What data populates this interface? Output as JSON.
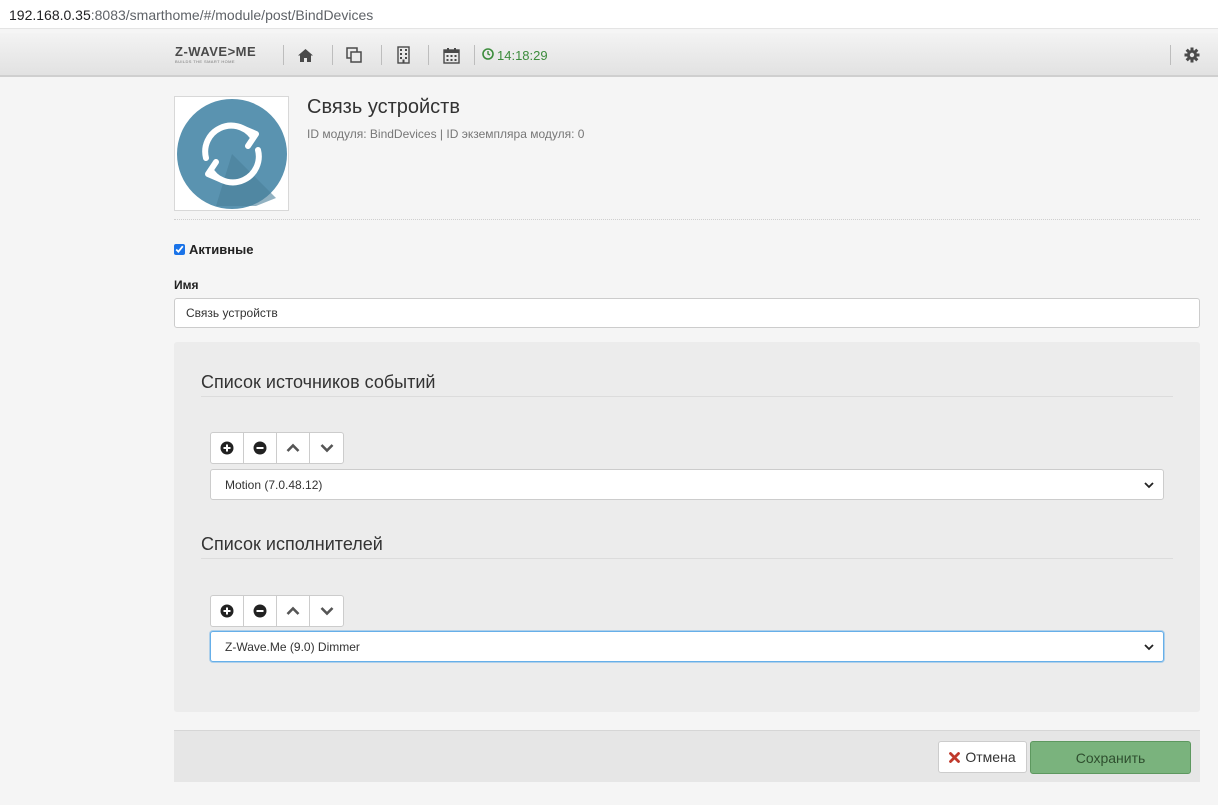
{
  "browser": {
    "url_host": "192.168.0.35",
    "url_rest": ":8083/smarthome/#/module/post/BindDevices"
  },
  "nav": {
    "logo_text": "Z-WAVE>ME",
    "logo_tagline": "BUILDS THE SMART HOME",
    "time": "14:18:29",
    "icons": [
      "home-icon",
      "copy-icon",
      "building-icon",
      "calendar-icon",
      "clock-icon",
      "gear-icon"
    ]
  },
  "module": {
    "title": "Связь устройств",
    "subtitle": "ID модуля: BindDevices | ID экземпляра модуля: 0",
    "icon": "refresh-icon"
  },
  "form": {
    "active_label": "Активные",
    "active_checked": true,
    "name_label": "Имя",
    "name_value": "Связь устройств"
  },
  "sources": {
    "title": "Список источников событий",
    "selected": "Motion (7.0.48.12)"
  },
  "targets": {
    "title": "Список исполнителей",
    "selected": "Z-Wave.Me (9.0) Dimmer"
  },
  "footer": {
    "cancel_label": "Отмена",
    "save_label": "Сохранить"
  },
  "colors": {
    "accent_green": "#7ab37d",
    "clock_green": "#3c8c3c",
    "cancel_red": "#c0392b",
    "module_icon_bg": "#5a93b0"
  }
}
